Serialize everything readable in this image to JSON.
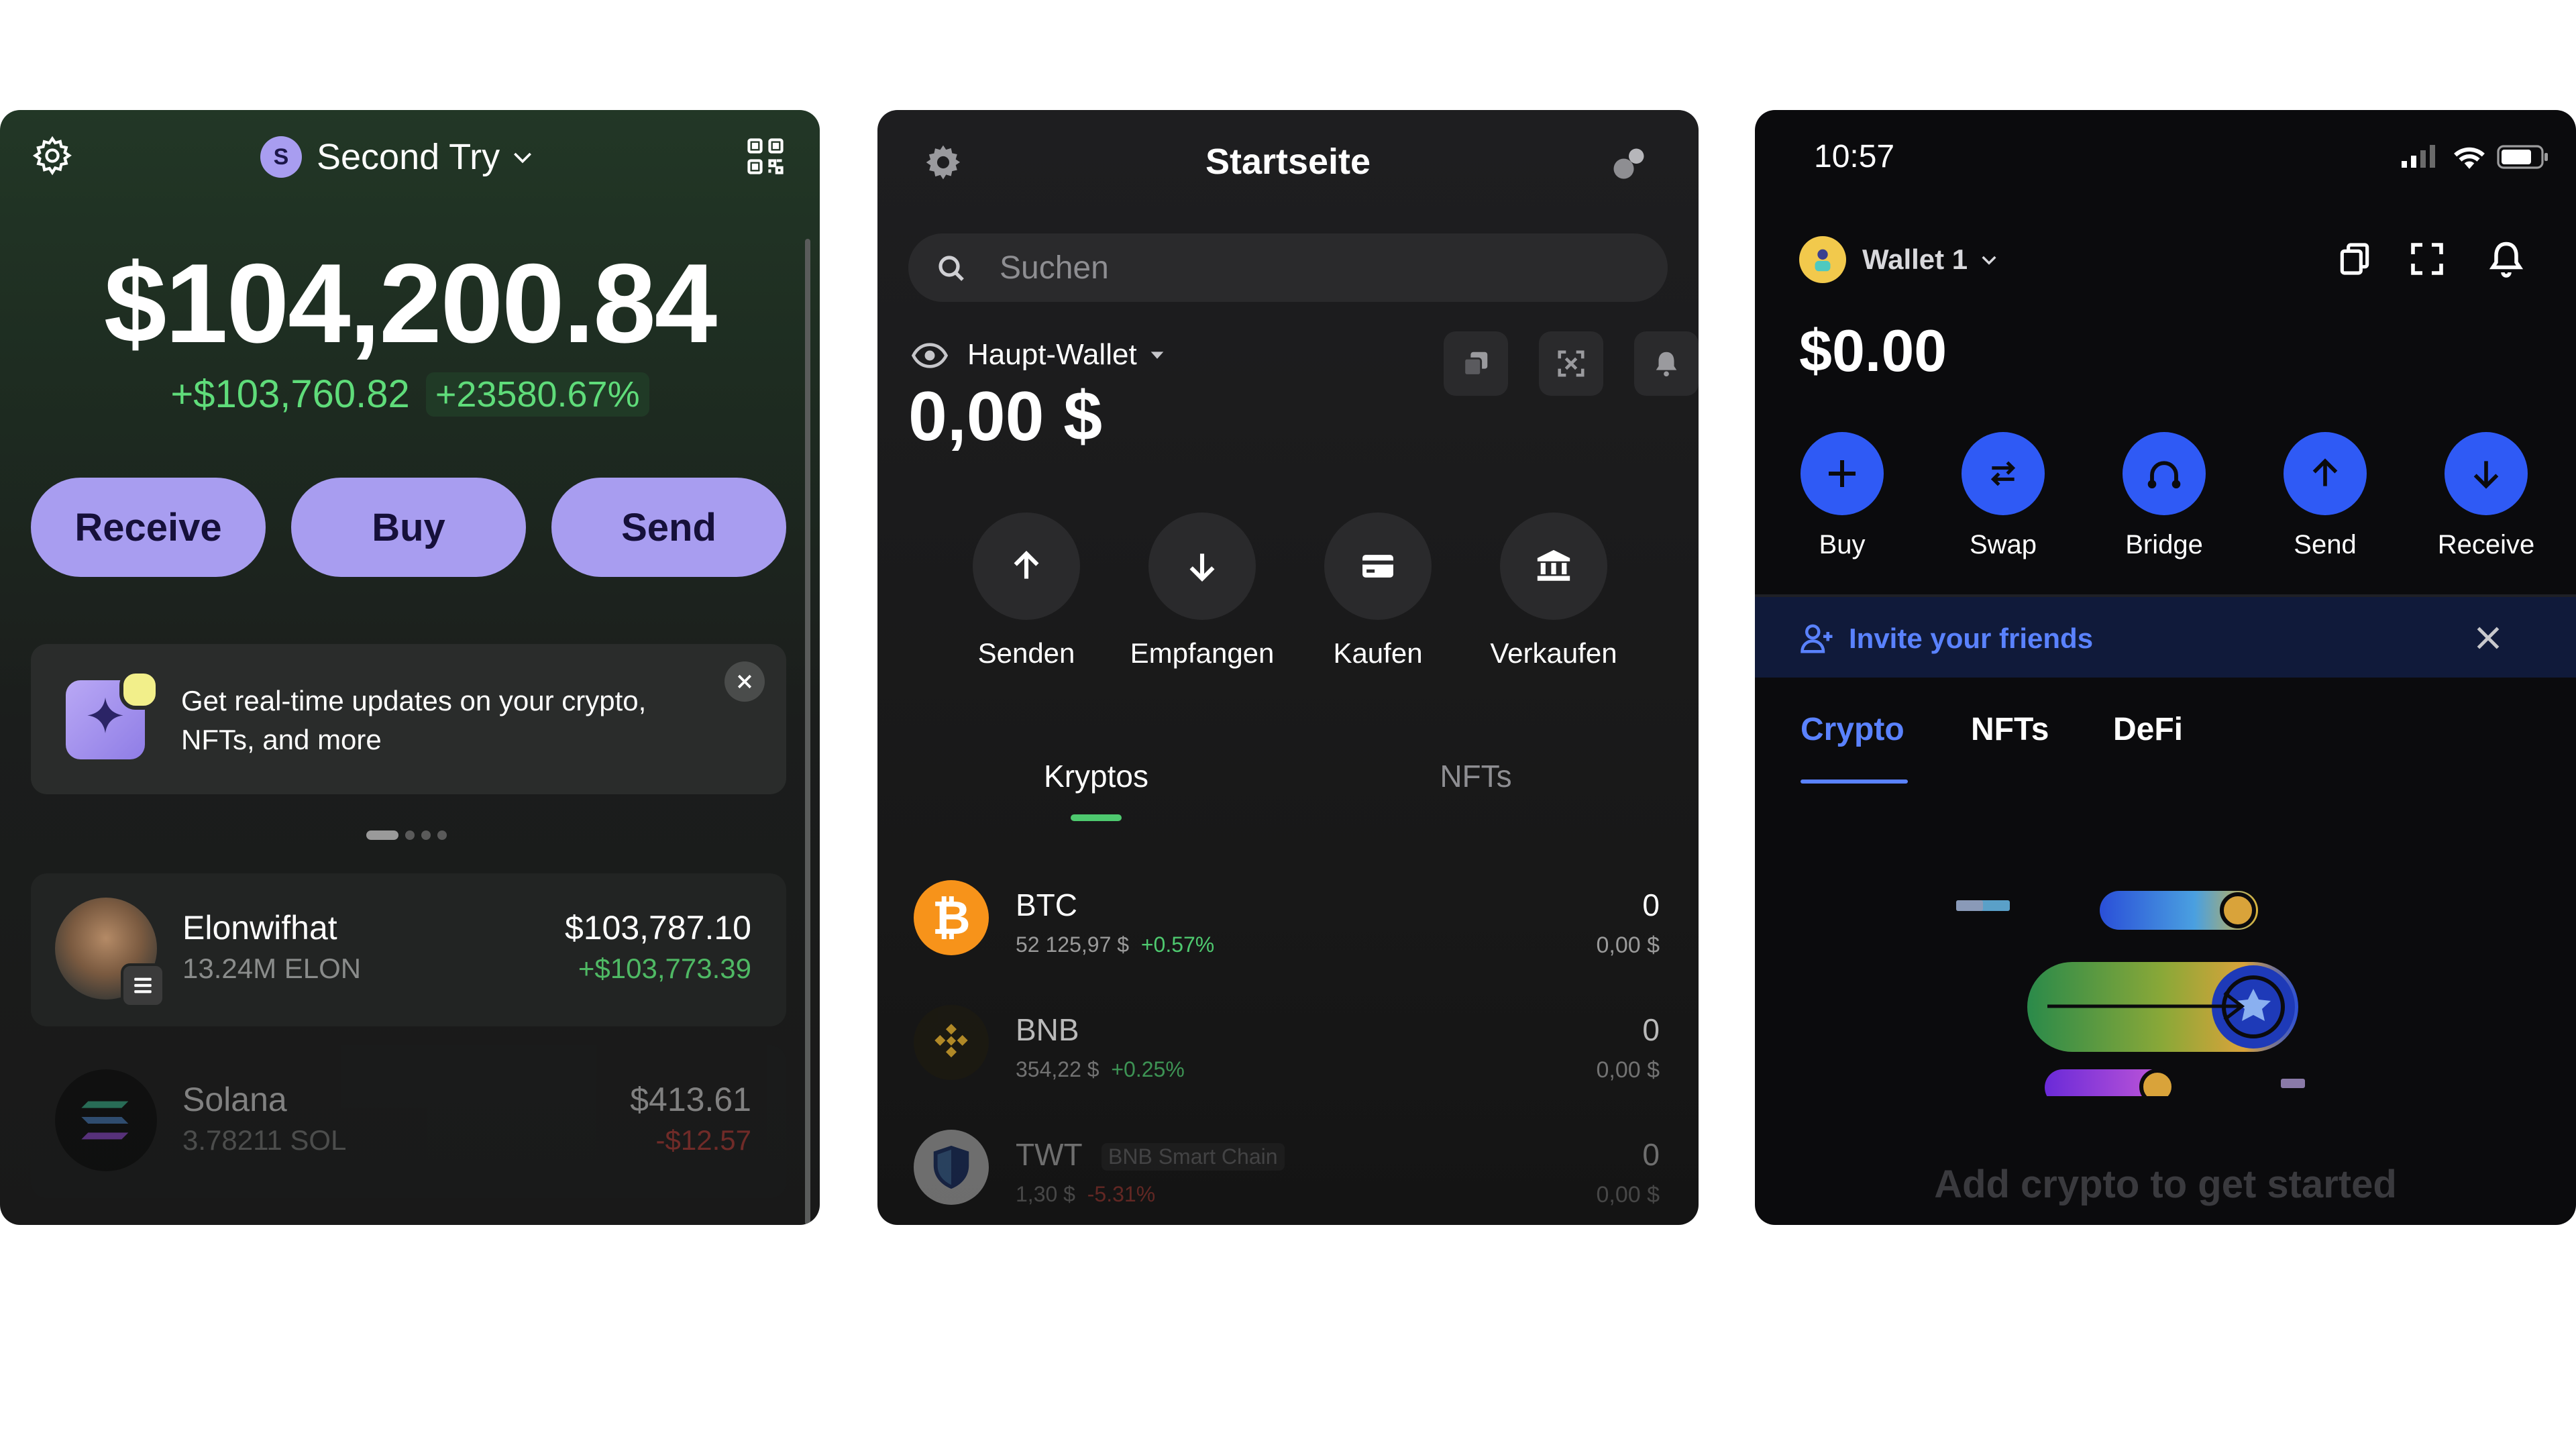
{
  "screen1": {
    "wallet_initial": "S",
    "wallet_name": "Second Try",
    "balance": "$104,200.84",
    "change_amount": "+$103,760.82",
    "change_percent": "+23580.67%",
    "actions": [
      "Receive",
      "Buy",
      "Send"
    ],
    "banner_line1": "Get real-time updates on your crypto,",
    "banner_line2": "NFTs, and more",
    "assets": [
      {
        "name": "Elonwifhat",
        "amount": "13.24M ELON",
        "value": "$103,787.10",
        "change": "+$103,773.39"
      },
      {
        "name": "Solana",
        "amount": "3.78211 SOL",
        "value": "$413.61",
        "change": "-$12.57"
      }
    ],
    "pager_dots": 4,
    "icons": [
      "gear-icon",
      "chevron-down-icon",
      "qr-code-icon",
      "sparkle-icon",
      "close-icon"
    ],
    "accent": "#a89df0",
    "positive": "#5fdc7a",
    "negative": "#d9413a"
  },
  "screen2": {
    "title": "Startseite",
    "search_placeholder": "Suchen",
    "wallet_name": "Haupt-Wallet",
    "balance": "0,00 $",
    "actions": [
      "Senden",
      "Empfangen",
      "Kaufen",
      "Verkaufen"
    ],
    "tabs": [
      "Kryptos",
      "NFTs"
    ],
    "coins": [
      {
        "symbol": "BTC",
        "price": "52 125,97 $",
        "change": "+0.57%",
        "qty": "0",
        "value": "0,00 $"
      },
      {
        "symbol": "BNB",
        "price": "354,22 $",
        "change": "+0.25%",
        "qty": "0",
        "value": "0,00 $"
      },
      {
        "symbol": "TWT",
        "chain": "BNB Smart Chain",
        "price": "1,30 $",
        "change": "-5.31%",
        "qty": "0",
        "value": "0,00 $"
      }
    ],
    "icons": [
      "gear-icon",
      "link-icon",
      "search-icon",
      "eye-icon",
      "copy-icon",
      "scan-icon",
      "bell-icon"
    ],
    "accent": "#4ec96f"
  },
  "screen3": {
    "time": "10:57",
    "wallet_name": "Wallet 1",
    "balance": "$0.00",
    "actions": [
      "Buy",
      "Swap",
      "Bridge",
      "Send",
      "Receive"
    ],
    "invite_text": "Invite your friends",
    "tabs": [
      "Crypto",
      "NFTs",
      "DeFi"
    ],
    "empty_text": "Add crypto to get started",
    "icons": [
      "signal-icon",
      "wifi-icon",
      "battery-icon",
      "copy-icon",
      "expand-icon",
      "bell-icon",
      "add-user-icon",
      "close-icon"
    ],
    "accent": "#2f5af5"
  }
}
